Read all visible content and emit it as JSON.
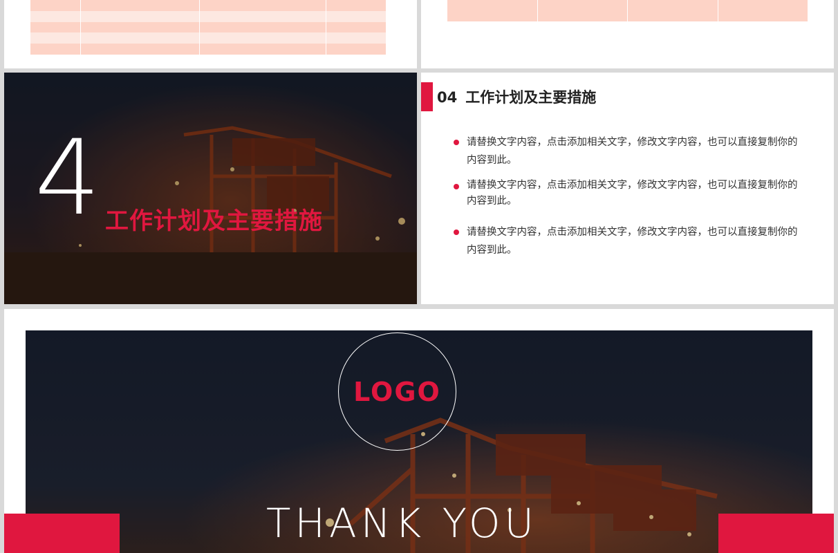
{
  "colors": {
    "accent": "#e0173f",
    "table_dark": "#fdd3c6",
    "table_light": "#fde8e1",
    "background": "#d9d9d9"
  },
  "section_slide": {
    "number": "4",
    "title": "工作计划及主要措施"
  },
  "content_slide": {
    "number": "04",
    "title": "工作计划及主要措施",
    "bullets": [
      "请替换文字内容，点击添加相关文字，修改文字内容，也可以直接复制你的内容到此。",
      "请替换文字内容，点击添加相关文字，修改文字内容，也可以直接复制你的内容到此。",
      "请替换文字内容，点击添加相关文字，修改文字内容，也可以直接复制你的内容到此。"
    ]
  },
  "thanks_slide": {
    "logo": "LOGO",
    "thanks": "THANK YOU"
  }
}
